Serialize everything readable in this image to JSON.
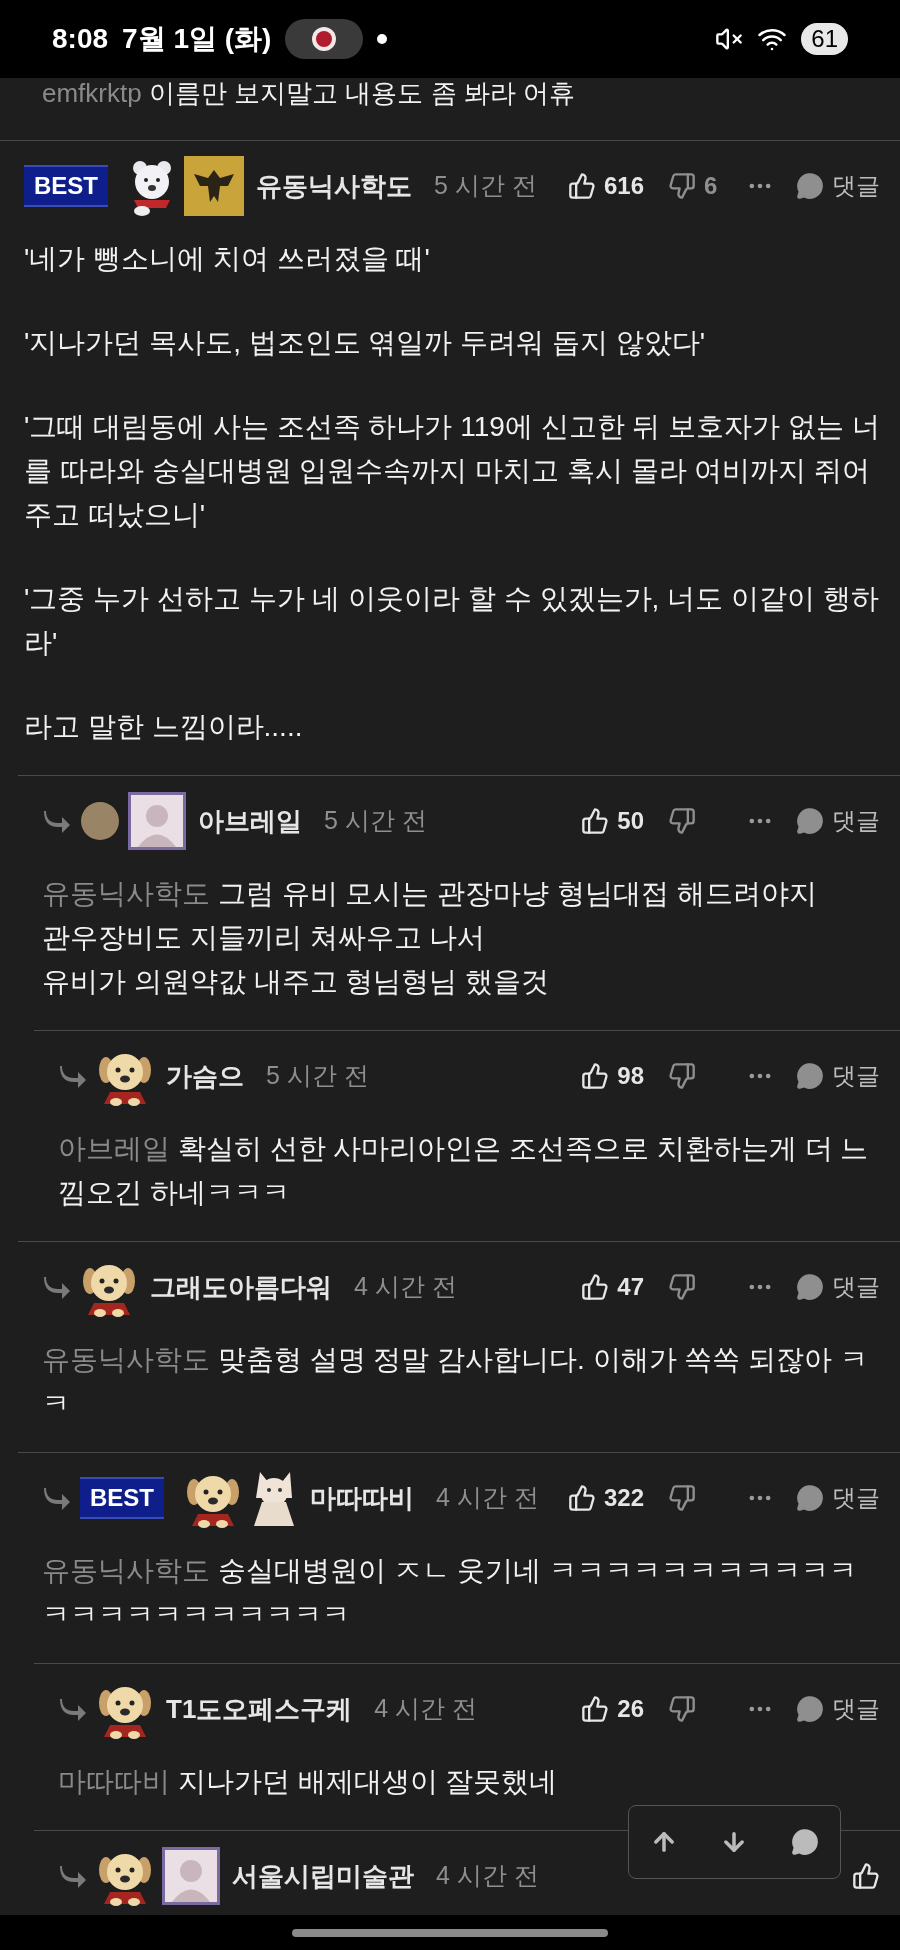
{
  "status_bar": {
    "time": "8:08",
    "date": "7월 1일 (화)",
    "battery": "61"
  },
  "previous_comment": {
    "mention": "emfkrktp",
    "text": "이름만 보지말고 내용도 좀 봐라 어휴"
  },
  "comments": [
    {
      "badge": "BEST",
      "avatars": [
        {
          "kind": "bear"
        },
        {
          "kind": "emblem"
        }
      ],
      "author": "유동닉사학도",
      "time": "5 시간 전",
      "likes": "616",
      "dislikes": "6",
      "reply_label": "댓글",
      "paragraphs": [
        "'네가 뺑소니에 치여 쓰러졌을 때'",
        "'지나가던 목사도, 법조인도 엮일까 두려워 돕지 않았다'",
        "'그때 대림동에 사는 조선족 하나가 119에 신고한 뒤 보호자가 없는 너를 따라와 숭실대병원 입원수속까지 마치고 혹시 몰라 여비까지 쥐어주고 떠났으니'",
        "'그중 누가 선하고 누가 네 이웃이라 할 수 있겠는가, 너도 이같이 행하라'",
        "라고 말한 느낌이라....."
      ],
      "replies": [
        {
          "avatars": [
            {
              "kind": "ball"
            },
            {
              "kind": "portrait"
            }
          ],
          "author": "아브레일",
          "time": "5 시간 전",
          "likes": "50",
          "reply_label": "댓글",
          "mention": "유동닉사학도",
          "paragraphs": [
            "그럼 유비 모시는 관장마냥 형님대접 해드려야지\n관우장비도 지들끼리 쳐싸우고 나서\n유비가 의원약값 내주고 형님형님 했을것"
          ],
          "replies": [
            {
              "avatars": [
                {
                  "kind": "dog"
                }
              ],
              "author": "가슴으",
              "time": "5 시간 전",
              "likes": "98",
              "reply_label": "댓글",
              "mention": "아브레일",
              "paragraphs": [
                "확실히 선한 사마리아인은 조선족으로 치환하는게 더 느낌오긴 하네ㅋㅋㅋ"
              ]
            }
          ]
        },
        {
          "avatars": [
            {
              "kind": "dog"
            }
          ],
          "author": "그래도아름다워",
          "time": "4 시간 전",
          "likes": "47",
          "reply_label": "댓글",
          "mention": "유동닉사학도",
          "paragraphs": [
            "맞춤형 설명 정말 감사합니다. 이해가 쏙쏙 되잖아 ㅋㅋ"
          ]
        },
        {
          "badge": "BEST",
          "avatars": [
            {
              "kind": "dog"
            },
            {
              "kind": "cat"
            }
          ],
          "author": "마따따비",
          "time": "4 시간 전",
          "likes": "322",
          "reply_label": "댓글",
          "mention": "유동닉사학도",
          "paragraphs": [
            "숭실대병원이 ㅈㄴ 웃기네 ㅋㅋㅋㅋㅋㅋㅋㅋㅋㅋㅋㅋㅋㅋㅋㅋㅋㅋㅋㅋㅋㅋ"
          ],
          "replies": [
            {
              "avatars": [
                {
                  "kind": "dog"
                }
              ],
              "author": "T1도오페스구케",
              "time": "4 시간 전",
              "likes": "26",
              "reply_label": "댓글",
              "mention": "마따따비",
              "paragraphs": [
                "지나가던 배제대생이 잘못했네"
              ]
            },
            {
              "avatars": [
                {
                  "kind": "dog"
                },
                {
                  "kind": "portrait"
                }
              ],
              "author": "서울시립미술관",
              "time": "4 시간 전"
            }
          ]
        }
      ]
    }
  ]
}
